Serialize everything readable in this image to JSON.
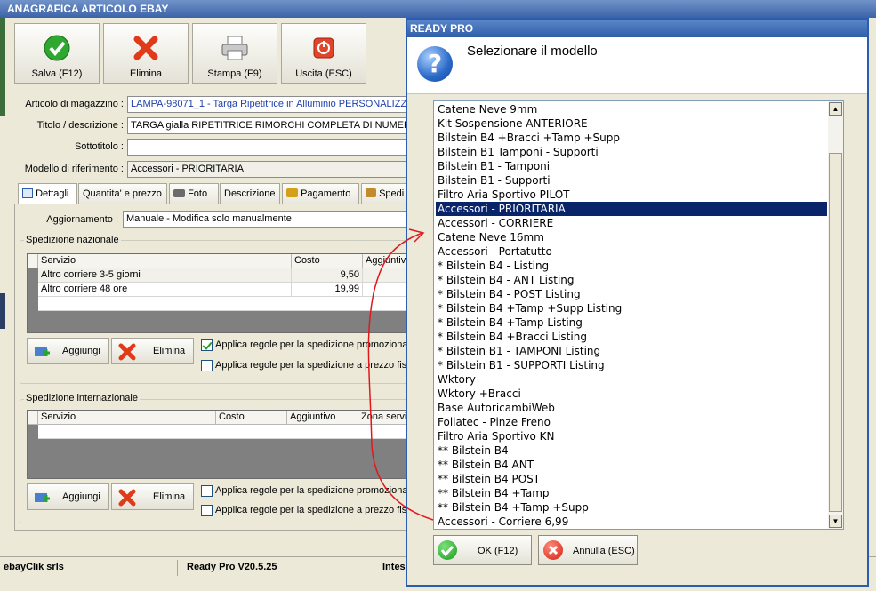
{
  "main_window": {
    "title": "ANAGRAFICA ARTICOLO EBAY",
    "toolbar": {
      "save": "Salva (F12)",
      "delete": "Elimina",
      "print": "Stampa (F9)",
      "exit": "Uscita (ESC)"
    },
    "form": {
      "article_label": "Articolo di magazzino :",
      "article_value": "LAMPA-98071_1 - Targa Ripetitrice in Alluminio PERSONALIZZATA",
      "title_label": "Titolo / descrizione :",
      "title_value": "TARGA gialla RIPETITRICE RIMORCHI COMPLETA DI NUMERI E L",
      "subtitle_label": "Sottotitolo :",
      "subtitle_value": "",
      "model_label": "Modello di riferimento :",
      "model_value": "Accessori - PRIORITARIA"
    },
    "tabs": [
      "Dettagli",
      "Quantita' e prezzo",
      "Foto",
      "Descrizione",
      "Pagamento",
      "Spedi"
    ],
    "update_label": "Aggiornamento :",
    "update_value": "Manuale - Modifica solo manualmente",
    "national": {
      "title": "Spedizione nazionale",
      "columns": [
        "Servizio",
        "Costo",
        "Aggiuntivo"
      ],
      "rows": [
        {
          "service": "Altro corriere 3-5 giorni",
          "cost": "9,50"
        },
        {
          "service": "Altro corriere 48 ore",
          "cost": "19,99"
        }
      ],
      "add": "Aggiungi",
      "delete": "Elimina",
      "check1": "Applica regole per la spedizione promozionale",
      "check2": "Applica regole per la spedizione a prezzo fisso"
    },
    "international": {
      "title": "Spedizione internazionale",
      "columns": [
        "Servizio",
        "Costo",
        "Aggiuntivo",
        "Zona servi"
      ],
      "add": "Aggiungi",
      "delete": "Elimina",
      "check1": "Applica regole per la spedizione promozionale",
      "check2": "Applica regole per la spedizione a prezzo fisso"
    },
    "status": {
      "company": "ebayClik srls",
      "version": "Ready Pro V20.5.25",
      "extra": "Intes"
    }
  },
  "dialog": {
    "title": "READY PRO",
    "message": "Selezionare il modello",
    "items": [
      "Catene Neve 9mm",
      "Kit Sospensione ANTERIORE",
      "Bilstein B4 +Bracci +Tamp +Supp",
      "Bilstein B1 Tamponi - Supporti",
      "Bilstein B1 - Tamponi",
      "Bilstein B1 - Supporti",
      "Filtro Aria Sportivo PILOT",
      "Accessori - PRIORITARIA",
      "Accessori - CORRIERE",
      "Catene Neve 16mm",
      "Accessori - Portatutto",
      "* Bilstein B4 - Listing",
      "* Bilstein B4 - ANT Listing",
      "* Bilstein B4 - POST Listing",
      "* Bilstein B4 +Tamp +Supp Listing",
      "* Bilstein B4 +Tamp Listing",
      "* Bilstein B4 +Bracci Listing",
      "* Bilstein B1 - TAMPONI Listing",
      "* Bilstein B1 - SUPPORTI Listing",
      "Wktory",
      "Wktory +Bracci",
      "Base AutoricambiWeb",
      "Foliatec - Pinze Freno",
      "Filtro Aria Sportivo KN",
      "** Bilstein B4",
      "** Bilstein B4 ANT",
      "** Bilstein B4 POST",
      "** Bilstein B4 +Tamp",
      "** Bilstein B4 +Tamp +Supp",
      "Accessori - Corriere 6,99"
    ],
    "selected_index": 7,
    "ok": "OK (F12)",
    "cancel": "Annulla (ESC)"
  }
}
